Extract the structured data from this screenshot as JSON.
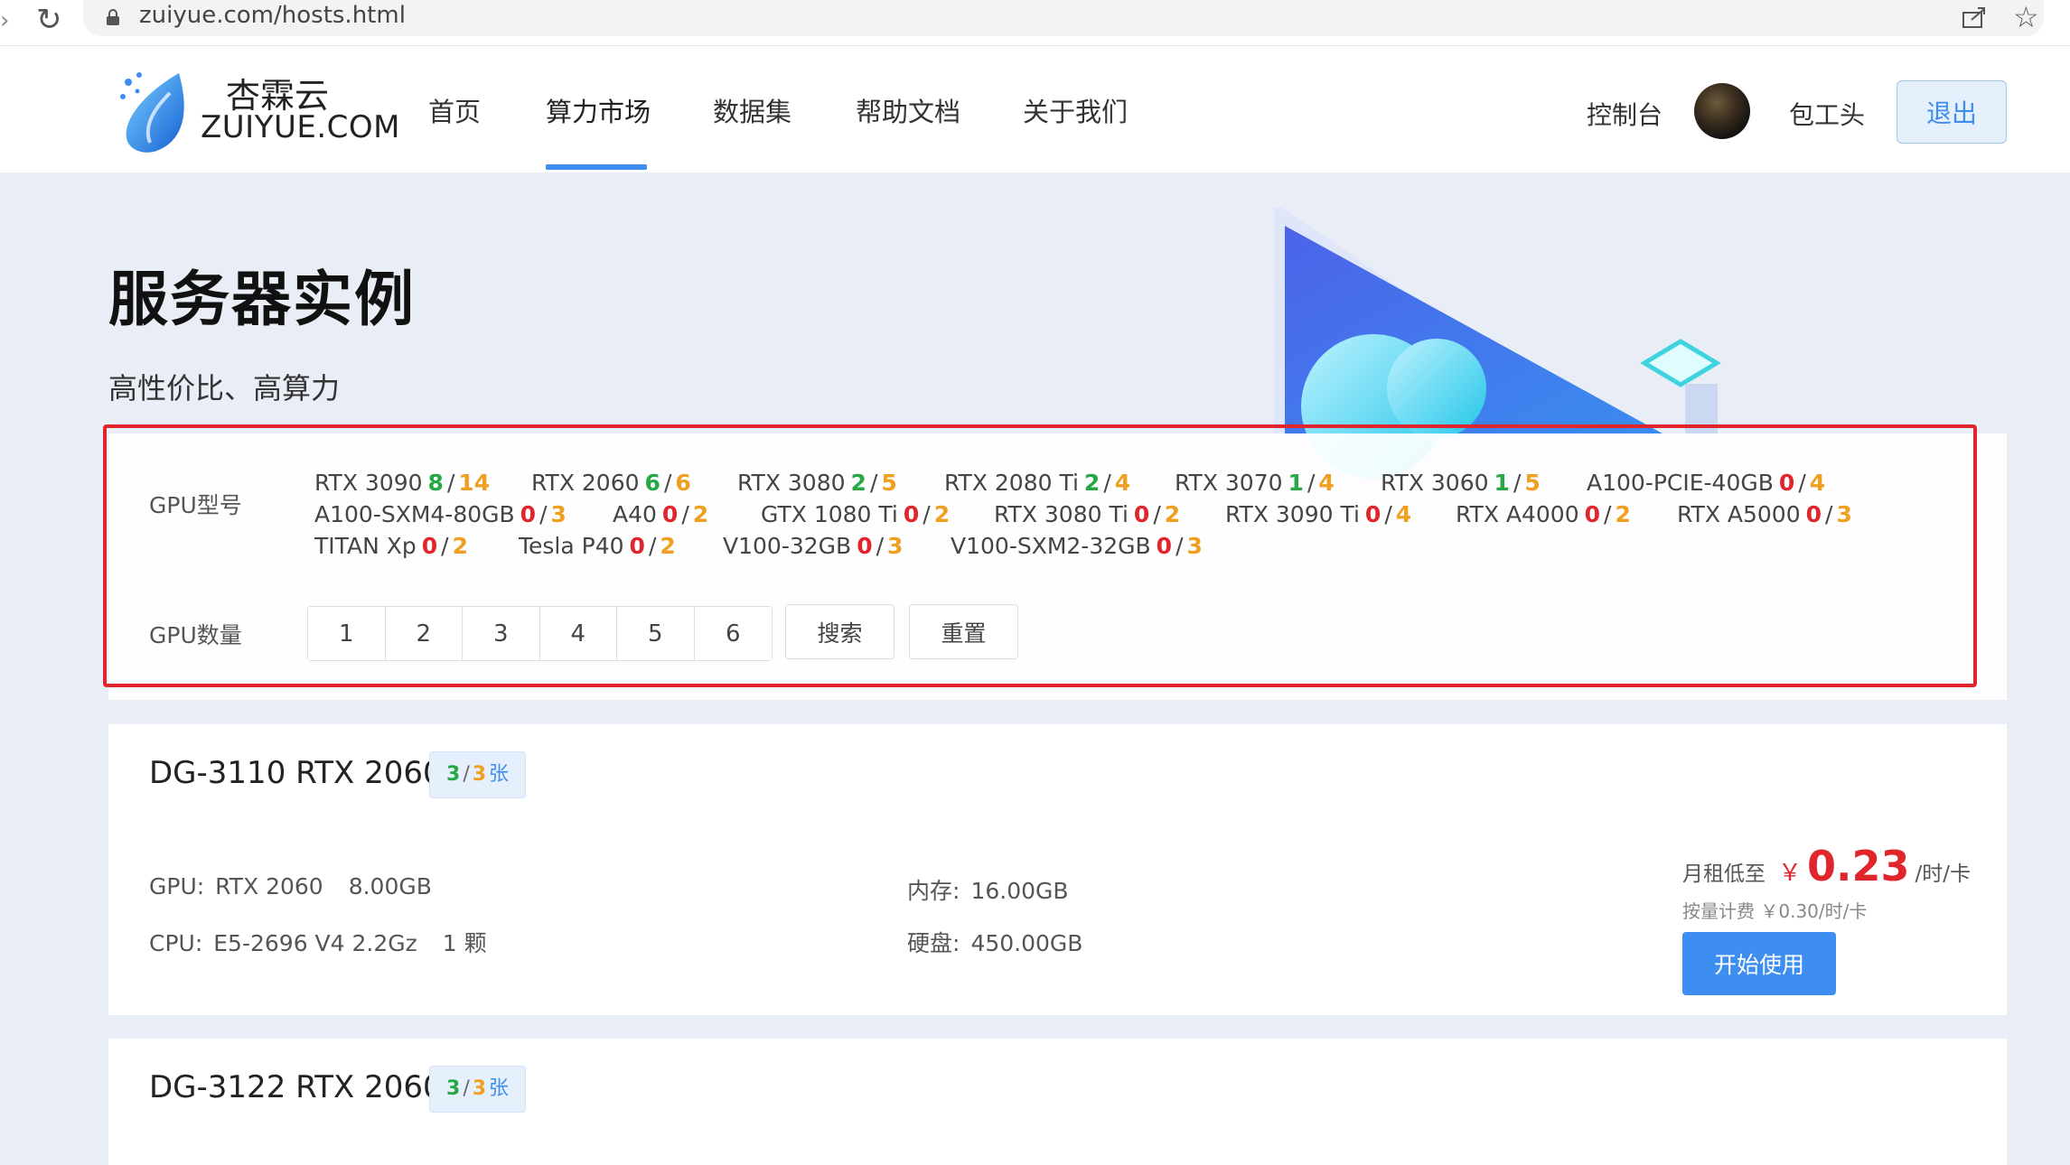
{
  "browser": {
    "url": "zuiyue.com/hosts.html",
    "icons": [
      "back-icon",
      "reload-icon",
      "lock-icon",
      "share-icon",
      "star-icon"
    ]
  },
  "site": {
    "logo_cn": "杏霖云",
    "logo_en": "ZUIYUE.COM",
    "nav": [
      "首页",
      "算力市场",
      "数据集",
      "帮助文档",
      "关于我们"
    ],
    "active_nav": "算力市场",
    "console": "控制台",
    "username": "包工头",
    "logout": "退出"
  },
  "hero": {
    "title": "服务器实例",
    "subtitle": "高性价比、高算力"
  },
  "filter": {
    "gpu_model_label": "GPU型号",
    "gpu_count_label": "GPU数量",
    "gpu_models": [
      {
        "name": "RTX 3090",
        "available": "8",
        "total": "14"
      },
      {
        "name": "RTX 2060",
        "available": "6",
        "total": "6"
      },
      {
        "name": "RTX 3080",
        "available": "2",
        "total": "5"
      },
      {
        "name": "RTX 2080 Ti",
        "available": "2",
        "total": "4"
      },
      {
        "name": "RTX 3070",
        "available": "1",
        "total": "4"
      },
      {
        "name": "RTX 3060",
        "available": "1",
        "total": "5"
      },
      {
        "name": "A100-PCIE-40GB",
        "available": "0",
        "total": "4"
      },
      {
        "name": "A100-SXM4-80GB",
        "available": "0",
        "total": "3"
      },
      {
        "name": "A40",
        "available": "0",
        "total": "2"
      },
      {
        "name": "GTX 1080 Ti",
        "available": "0",
        "total": "2"
      },
      {
        "name": "RTX 3080 Ti",
        "available": "0",
        "total": "2"
      },
      {
        "name": "RTX 3090 Ti",
        "available": "0",
        "total": "4"
      },
      {
        "name": "RTX A4000",
        "available": "0",
        "total": "2"
      },
      {
        "name": "RTX A5000",
        "available": "0",
        "total": "3"
      },
      {
        "name": "TITAN Xp",
        "available": "0",
        "total": "2"
      },
      {
        "name": "Tesla P40",
        "available": "0",
        "total": "2"
      },
      {
        "name": "V100-32GB",
        "available": "0",
        "total": "3"
      },
      {
        "name": "V100-SXM2-32GB",
        "available": "0",
        "total": "3"
      }
    ],
    "counts": [
      "1",
      "2",
      "3",
      "4",
      "5",
      "6"
    ],
    "search": "搜索",
    "reset": "重置"
  },
  "hosts": [
    {
      "name": "DG-3110 RTX 2060",
      "available": "3",
      "total": "3",
      "unit": "张",
      "gpu_label": "GPU:",
      "gpu_model": "RTX 2060",
      "gpu_mem": "8.00GB",
      "cpu_label": "CPU:",
      "cpu_model": "E5-2696 V4 2.2Gz",
      "cpu_count": "1 颗",
      "mem_label": "内存:",
      "mem": "16.00GB",
      "disk_label": "硬盘:",
      "disk": "450.00GB",
      "price_label": "月租低至",
      "currency": "￥",
      "price": "0.23",
      "price_unit": "/时/卡",
      "hourly": "按量计费 ￥0.30/时/卡",
      "start": "开始使用"
    },
    {
      "name": "DG-3122 RTX 2060",
      "available": "3",
      "total": "3",
      "unit": "张"
    }
  ],
  "colors": {
    "accent": "#3d8ef0",
    "price_red": "#e0262c",
    "available_green": "#28a745",
    "total_orange": "#f0a020",
    "highlight_box": "#e0262c"
  }
}
